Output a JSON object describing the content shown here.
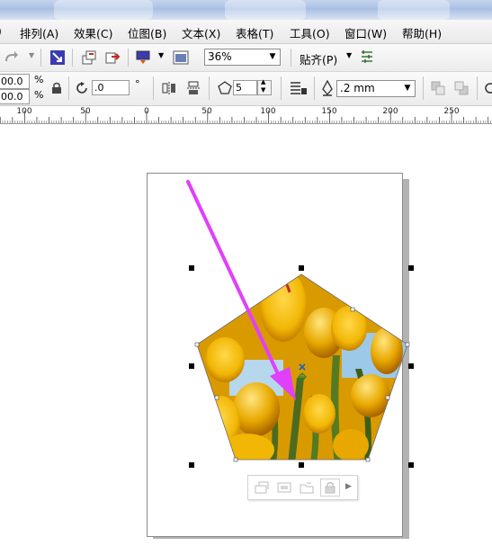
{
  "menu": [
    {
      "id": "arrange",
      "label": "排列(A)"
    },
    {
      "id": "effects",
      "label": "效果(C)"
    },
    {
      "id": "bitmaps",
      "label": "位图(B)"
    },
    {
      "id": "text",
      "label": "文本(X)"
    },
    {
      "id": "table",
      "label": "表格(T)"
    },
    {
      "id": "tools",
      "label": "工具(O)"
    },
    {
      "id": "window",
      "label": "窗口(W)"
    },
    {
      "id": "help",
      "label": "帮助(H)"
    }
  ],
  "toolbar1": {
    "zoom_value": "36%",
    "snap_label": "贴齐(P)"
  },
  "toolbar2": {
    "scale_x": "00.0",
    "scale_y": "00.0",
    "percent_x": "%",
    "percent_y": "%",
    "rotation_value": ".0",
    "degree_symbol": "°",
    "polygon_points": "5",
    "outline_width": ".2 mm"
  },
  "ruler": {
    "labels": [
      "100",
      "50",
      "0",
      "50",
      "100",
      "150",
      "200",
      "250"
    ]
  },
  "colors": {
    "arrow": "#e040fb",
    "tulip_yellow": "#f2b705",
    "tulip_orange": "#e08a00",
    "sky": "#9cc9e8",
    "stem_green": "#4c6b1f"
  },
  "icons": {
    "redo": "redo-arrow-icon",
    "import": "import-icon",
    "export": "export-icon",
    "publish_pdf": "publish-pdf-icon",
    "application_launcher": "application-launcher-icon",
    "welcome_screen": "welcome-screen-icon",
    "lock_ratio": "lock-ratio-icon",
    "rotate": "rotate-icon",
    "mirror_h": "mirror-horizontal-icon",
    "mirror_v": "mirror-vertical-icon",
    "polygon": "polygon-icon",
    "wrap_text": "wrap-text-icon",
    "outline_pen": "outline-pen-icon",
    "to_front": "to-front-icon",
    "to_back": "to-back-icon",
    "options": "options-icon"
  }
}
